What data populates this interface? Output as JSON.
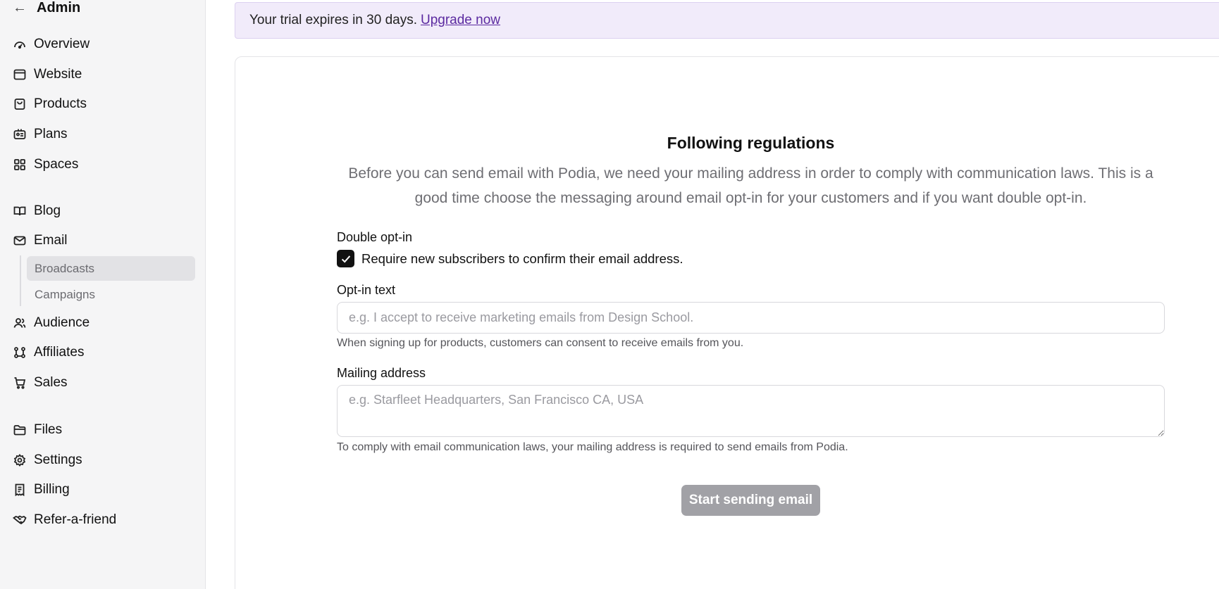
{
  "sidebar": {
    "back_label": "←",
    "title": "Admin",
    "items": [
      {
        "label": "Overview",
        "icon": "gauge-icon"
      },
      {
        "label": "Website",
        "icon": "browser-icon"
      },
      {
        "label": "Products",
        "icon": "bag-icon"
      },
      {
        "label": "Plans",
        "icon": "id-card-icon"
      },
      {
        "label": "Spaces",
        "icon": "grid-icon"
      },
      {
        "label": "Blog",
        "icon": "book-icon"
      },
      {
        "label": "Email",
        "icon": "mail-icon"
      },
      {
        "label": "Audience",
        "icon": "users-icon"
      },
      {
        "label": "Affiliates",
        "icon": "affiliates-icon"
      },
      {
        "label": "Sales",
        "icon": "cart-icon"
      },
      {
        "label": "Files",
        "icon": "folder-icon"
      },
      {
        "label": "Settings",
        "icon": "gear-icon"
      },
      {
        "label": "Billing",
        "icon": "receipt-icon"
      },
      {
        "label": "Refer-a-friend",
        "icon": "handshake-icon"
      }
    ],
    "email_subitems": [
      {
        "label": "Broadcasts",
        "active": true
      },
      {
        "label": "Campaigns",
        "active": false
      }
    ]
  },
  "banner": {
    "text": "Your trial expires in 30 days.",
    "link": "Upgrade now"
  },
  "main": {
    "heading": "Following regulations",
    "intro": "Before you can send email with Podia, we need your mailing address in order to comply with communication laws. This is a good time choose the messaging around email opt-in for your customers and if you want double opt-in.",
    "double_optin": {
      "label": "Double opt-in",
      "checkbox_label": "Require new subscribers to confirm their email address.",
      "checked": true
    },
    "optin_text": {
      "label": "Opt-in text",
      "value": "",
      "placeholder": "e.g. I accept to receive marketing emails from Design School.",
      "help": "When signing up for products, customers can consent to receive emails from you."
    },
    "mailing_address": {
      "label": "Mailing address",
      "value": "",
      "placeholder": "e.g. Starfleet Headquarters, San Francisco CA, USA",
      "help": "To comply with email communication laws, your mailing address is required to send emails from Podia."
    },
    "submit_label": "Start sending email"
  },
  "colors": {
    "sidebar_bg": "#f5f5f6",
    "banner_bg": "#f1ebfa",
    "link": "#5b2aa0",
    "button_disabled": "#a1a1a6"
  }
}
